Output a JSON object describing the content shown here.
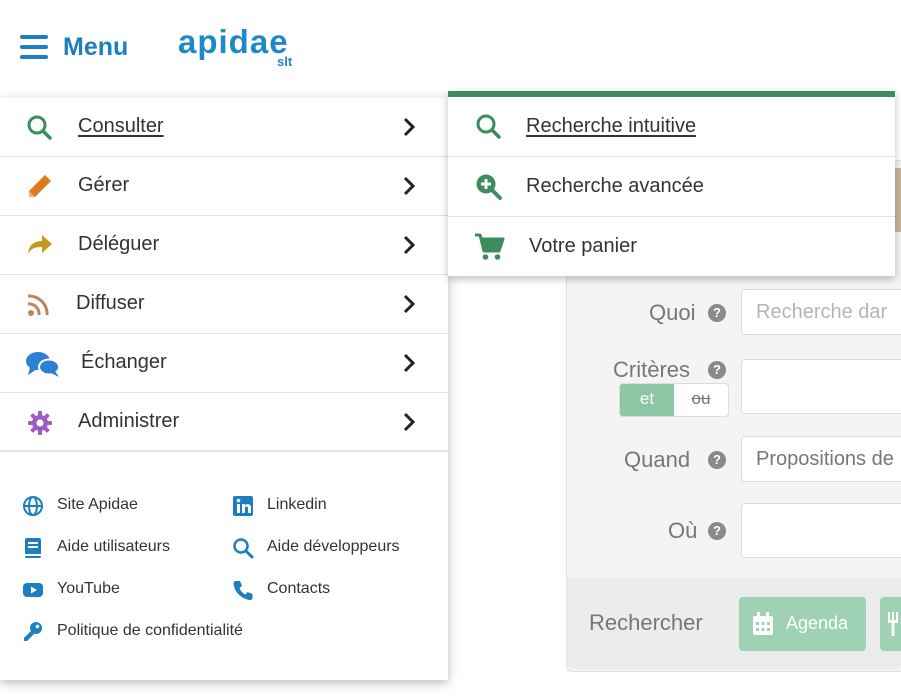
{
  "header": {
    "menu_label": "Menu",
    "logo_text": "apidae",
    "logo_sub": "slt",
    "brand_color": "#1e88c8"
  },
  "main_menu": {
    "items": [
      {
        "label": "Consulter",
        "icon": "search-icon",
        "color": "#3c8c5e"
      },
      {
        "label": "Gérer",
        "icon": "pencil-icon",
        "color": "#e07a1f"
      },
      {
        "label": "Déléguer",
        "icon": "share-arrow-icon",
        "color": "#c39a1f"
      },
      {
        "label": "Diffuser",
        "icon": "rss-icon",
        "color": "#b8875a"
      },
      {
        "label": "Échanger",
        "icon": "chat-bubbles-icon",
        "color": "#2f7fd6"
      },
      {
        "label": "Administrer",
        "icon": "gear-icon",
        "color": "#a05cc4"
      }
    ]
  },
  "submenu": {
    "accent": "#3c8c5e",
    "items": [
      {
        "label": "Recherche intuitive",
        "icon": "search-icon"
      },
      {
        "label": "Recherche avancée",
        "icon": "zoom-in-icon"
      },
      {
        "label": "Votre panier",
        "icon": "cart-icon"
      }
    ]
  },
  "footer_links": {
    "site": "Site Apidae",
    "linkedin": "Linkedin",
    "aide_utilisateurs": "Aide utilisateurs",
    "aide_developpeurs": "Aide développeurs",
    "youtube": "YouTube",
    "contacts": "Contacts",
    "politique": "Politique de confidentialité"
  },
  "form": {
    "quoi_label": "Quoi",
    "quoi_placeholder": "Recherche dar",
    "criteres_label": "Critères",
    "toggle_et": "et",
    "toggle_ou": "ou",
    "quand_label": "Quand",
    "quand_value": "Propositions de",
    "ou_label": "Où",
    "help": "?",
    "rechercher_label": "Rechercher",
    "agenda_button": "Agenda"
  }
}
